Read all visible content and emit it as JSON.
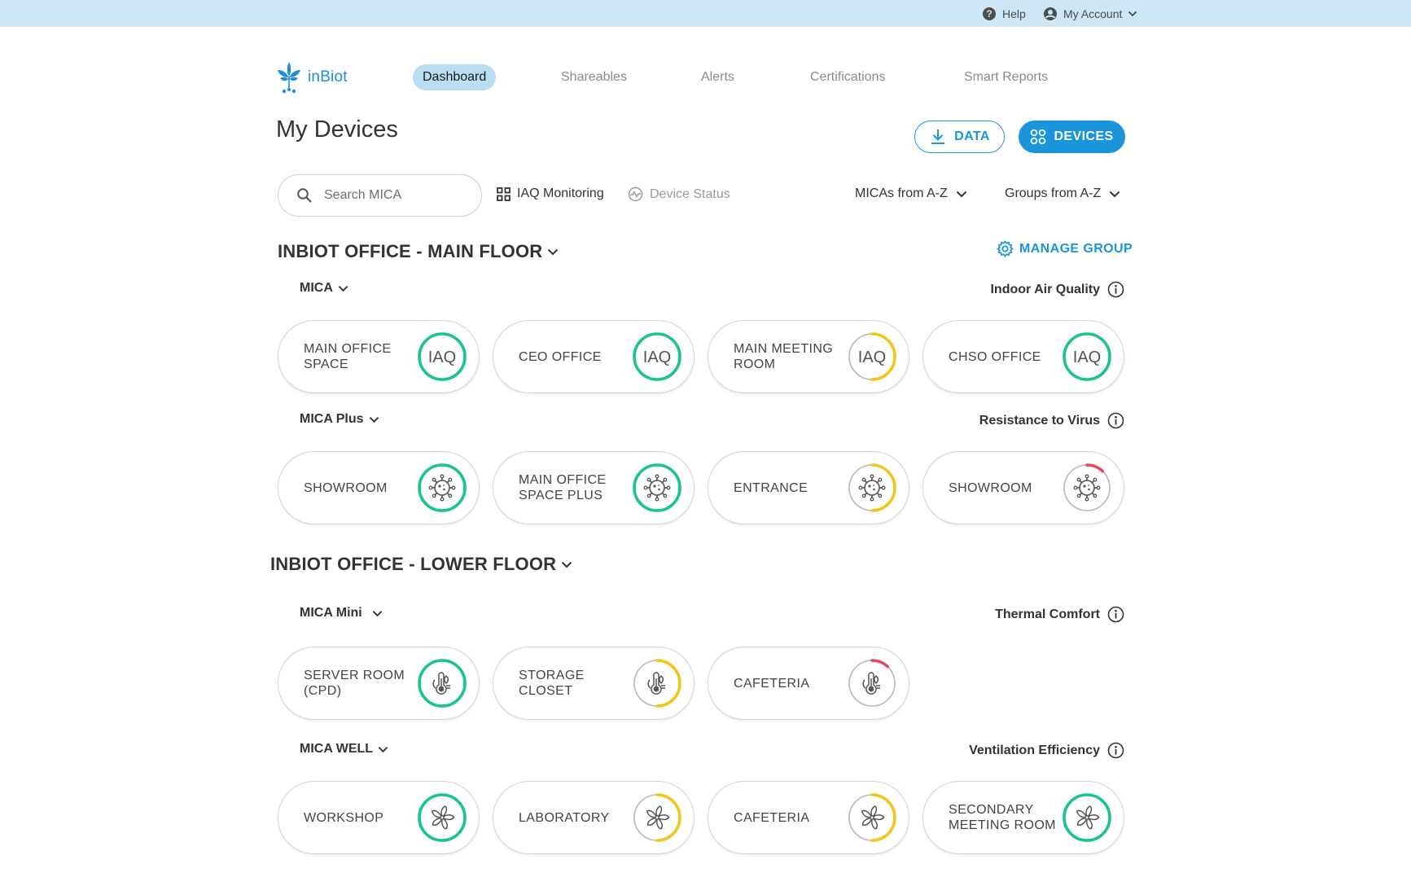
{
  "topbar": {
    "help_label": "Help",
    "account_label": "My Account"
  },
  "logo": {
    "text": "inBiot"
  },
  "nav": {
    "items": [
      {
        "label": "Dashboard",
        "active": true
      },
      {
        "label": "Shareables",
        "active": false
      },
      {
        "label": "Alerts",
        "active": false
      },
      {
        "label": "Certifications",
        "active": false
      },
      {
        "label": "Smart Reports",
        "active": false
      }
    ]
  },
  "page": {
    "title": "My Devices"
  },
  "buttons": {
    "data_label": "DATA",
    "devices_label": "DEVICES"
  },
  "search": {
    "placeholder": "Search MICA",
    "value": ""
  },
  "views": {
    "iaq_label": "IAQ Monitoring",
    "status_label": "Device Status",
    "active": "IAQ Monitoring"
  },
  "sort": {
    "micas_label": "MICAs from A-Z",
    "groups_label": "Groups from A-Z"
  },
  "colors": {
    "good": "#1bc489",
    "medium": "#f2c51a",
    "bad": "#e8455f",
    "track": "#b8b8b8",
    "accent": "#1a95dc"
  },
  "groups": [
    {
      "title": "INBIOT OFFICE - MAIN FLOOR",
      "manage_label": "MANAGE GROUP",
      "sections": [
        {
          "title": "MICA",
          "metric": "Indoor Air Quality",
          "icon": "iaq-text",
          "devices": [
            {
              "name": "MAIN OFFICE SPACE",
              "status": "good",
              "level": 1.0
            },
            {
              "name": "CEO OFFICE",
              "status": "good",
              "level": 1.0
            },
            {
              "name": "MAIN MEETING ROOM",
              "status": "medium",
              "level": 0.5
            },
            {
              "name": "CHSO OFFICE",
              "status": "good",
              "level": 1.0
            }
          ]
        },
        {
          "title": "MICA Plus",
          "metric": "Resistance to Virus",
          "icon": "virus-icon",
          "devices": [
            {
              "name": "SHOWROOM",
              "status": "good",
              "level": 1.0
            },
            {
              "name": "MAIN OFFICE SPACE PLUS",
              "status": "good",
              "level": 1.0
            },
            {
              "name": "ENTRANCE",
              "status": "medium",
              "level": 0.5
            },
            {
              "name": "SHOWROOM",
              "status": "bad",
              "level": 0.12
            }
          ]
        }
      ]
    },
    {
      "title": "INBIOT OFFICE - LOWER FLOOR",
      "sections": [
        {
          "title": "MICA Mini",
          "metric": "Thermal Comfort",
          "icon": "thermometer-icon",
          "devices": [
            {
              "name": "SERVER ROOM (CPD)",
              "status": "good",
              "level": 1.0
            },
            {
              "name": "STORAGE CLOSET",
              "status": "medium",
              "level": 0.5
            },
            {
              "name": "CAFETERIA",
              "status": "bad",
              "level": 0.12
            }
          ]
        },
        {
          "title": "MICA WELL",
          "metric": "Ventilation Efficiency",
          "icon": "fan-icon",
          "devices": [
            {
              "name": "WORKSHOP",
              "status": "good",
              "level": 1.0
            },
            {
              "name": "LABORATORY",
              "status": "medium",
              "level": 0.5
            },
            {
              "name": "CAFETERIA",
              "status": "medium",
              "level": 0.5
            },
            {
              "name": "SECONDARY MEETING ROOM",
              "status": "good",
              "level": 1.0
            }
          ]
        }
      ]
    }
  ]
}
